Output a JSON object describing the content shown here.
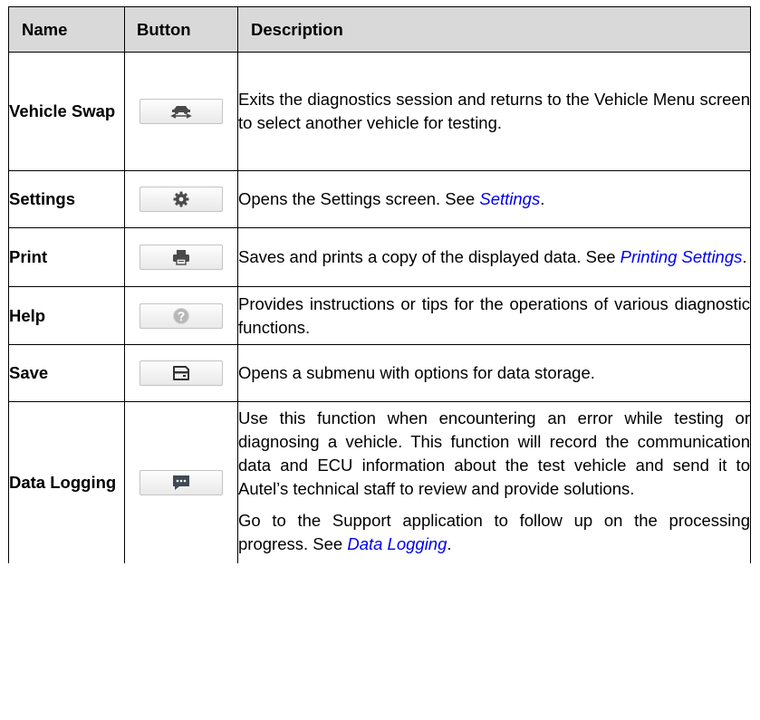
{
  "headers": {
    "name": "Name",
    "button": "Button",
    "description": "Description"
  },
  "rows": [
    {
      "name": "Vehicle Swap",
      "icon": "vehicle-swap-icon",
      "description": "Exits the diagnostics session and returns to the Vehicle Menu screen to select another vehicle for testing."
    },
    {
      "name": "Settings",
      "icon": "gear-icon",
      "description_pre": "Opens the Settings screen. See ",
      "link": "Settings",
      "description_post": "."
    },
    {
      "name": "Print",
      "icon": "printer-icon",
      "description_pre": "Saves and prints a copy of the displayed data. See ",
      "link": "Printing Settings",
      "description_post": "."
    },
    {
      "name": "Help",
      "icon": "help-icon",
      "description": "Provides instructions or tips for the operations of various diagnostic functions."
    },
    {
      "name": "Save",
      "icon": "save-icon",
      "description": "Opens a submenu with options for data storage."
    },
    {
      "name": "Data Logging",
      "icon": "chat-icon",
      "description": "Use this function when encountering an error while testing or diagnosing a vehicle. This function will record the communication data and ECU information about the test vehicle and send it to Autel’s technical staff to review and provide solutions.",
      "description2_pre": "Go to the Support application to follow up on the processing progress. See ",
      "link": "Data Logging",
      "description2_post": "."
    }
  ],
  "colors": {
    "header_bg": "#d9d9d9",
    "link": "#0000ee",
    "border": "#000000"
  }
}
